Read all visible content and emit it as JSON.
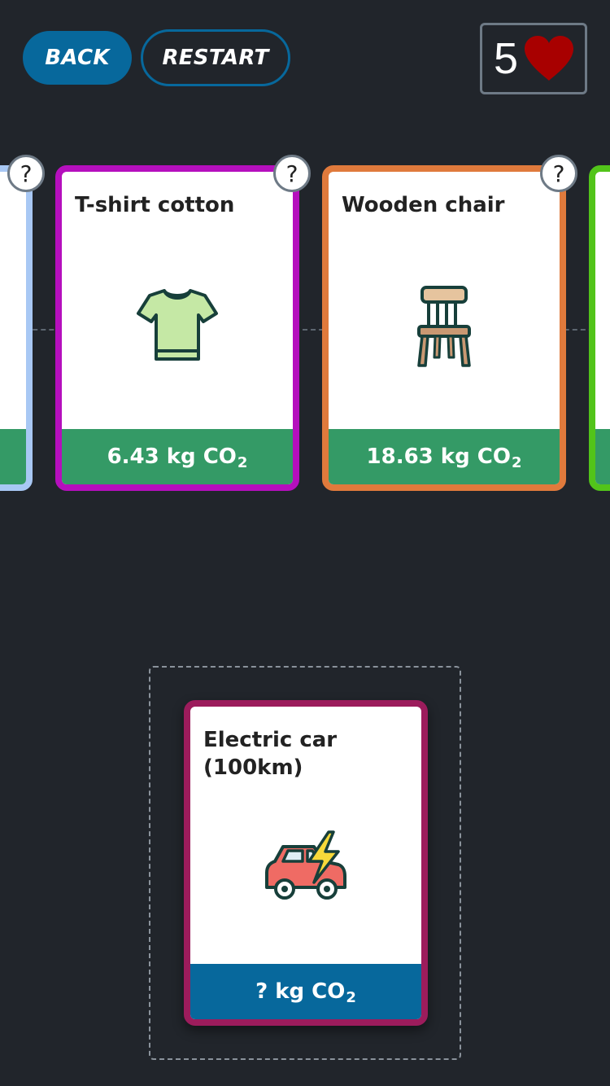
{
  "toolbar": {
    "back_label": "BACK",
    "restart_label": "RESTART"
  },
  "lives": {
    "count": "5",
    "icon": "heart-icon",
    "color": "#a80000"
  },
  "timeline": {
    "cards": [
      {
        "title": "",
        "footer_value": "",
        "border_color": "#a8c8f4",
        "partial": "left"
      },
      {
        "title": "T-shirt cotton",
        "footer_value": "6.43 kg CO",
        "footer_sub": "2",
        "icon": "tshirt-icon",
        "border_color": "#b50fbd"
      },
      {
        "title": "Wooden chair",
        "footer_value": "18.63 kg CO",
        "footer_sub": "2",
        "icon": "chair-icon",
        "border_color": "#e07a3c"
      },
      {
        "title": "",
        "footer_value": "",
        "border_color": "#52c41a",
        "partial": "right"
      }
    ],
    "help_label": "?"
  },
  "active_card": {
    "title": "Electric car (100km)",
    "footer_value": "? kg CO",
    "footer_sub": "2",
    "icon": "electric-car-icon",
    "border_color": "#9c1c5c"
  },
  "colors": {
    "background": "#21252b",
    "primary_blue": "#07689c",
    "footer_green": "#349a66"
  }
}
